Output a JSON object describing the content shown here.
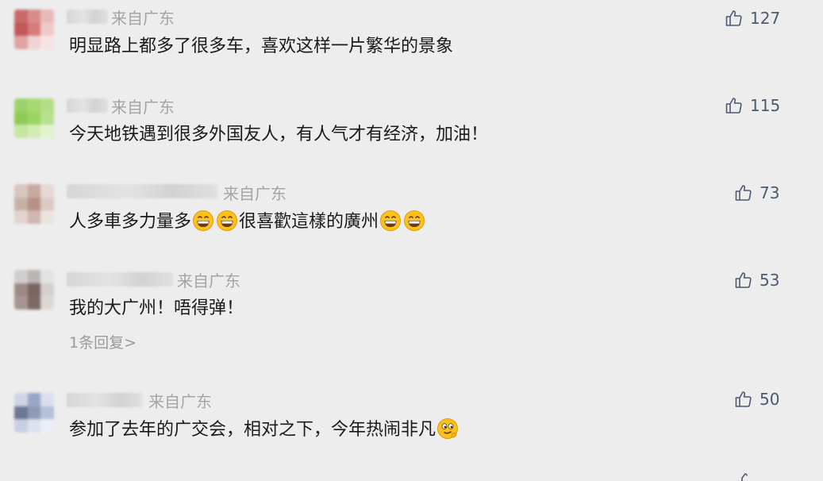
{
  "comments": [
    {
      "source": "来自广东",
      "text": "明显路上都多了很多车，喜欢这样一片繁华的景象",
      "likes": "127",
      "avatar_colors": [
        "#c96a6a",
        "#d98b8b",
        "#e9b9b9",
        "#c25858",
        "#d77c7c",
        "#efcaca",
        "#e1a3a3",
        "#f1d3d3",
        "#f6e3e3"
      ]
    },
    {
      "source": "来自广东",
      "text": "今天地铁遇到很多外国友人，有人气才有经济，加油！",
      "likes": "115",
      "avatar_colors": [
        "#9bd36a",
        "#a6d971",
        "#b4df85",
        "#8fcb55",
        "#9dd561",
        "#b8e08e",
        "#c6e6a2",
        "#d2ecb5",
        "#e3f2cf"
      ]
    },
    {
      "source": "来自广东",
      "text_parts": [
        "人多車多力量多",
        "很喜歡這樣的廣州"
      ],
      "likes": "73",
      "avatar_colors": [
        "#d8c6c0",
        "#c9a8a0",
        "#e7d8d3",
        "#c7b0a8",
        "#b79186",
        "#dcc9c2",
        "#e2d3ce",
        "#cdb7b0",
        "#ece2de"
      ]
    },
    {
      "source": "来自广东",
      "text": "我的大广州！唔得弹！",
      "likes": "53",
      "reply": "1条回复>",
      "avatar_colors": [
        "#cfcfcf",
        "#bdb5b2",
        "#e3e3e3",
        "#9c8a85",
        "#7a6660",
        "#d4cfcd",
        "#a69592",
        "#7c6a66",
        "#dcd8d6"
      ]
    },
    {
      "source": "来自广东",
      "text": "参加了去年的广交会，相对之下，今年热闹非凡",
      "likes": "50",
      "avatar_colors": [
        "#cfd5e6",
        "#9aa6c6",
        "#d9dfec",
        "#6d7796",
        "#8e9ab8",
        "#b6c0da",
        "#c8cfe2",
        "#dde2ee",
        "#eaeef5"
      ]
    }
  ],
  "icons": {
    "like": "thumbs-up-icon",
    "grin": "grinning-face-emoji",
    "smirk": "smirking-face-emoji"
  },
  "colors": {
    "background": "#ededed",
    "text": "#1a1a1a",
    "source": "#a4a4a4",
    "like": "#4a5a73"
  }
}
